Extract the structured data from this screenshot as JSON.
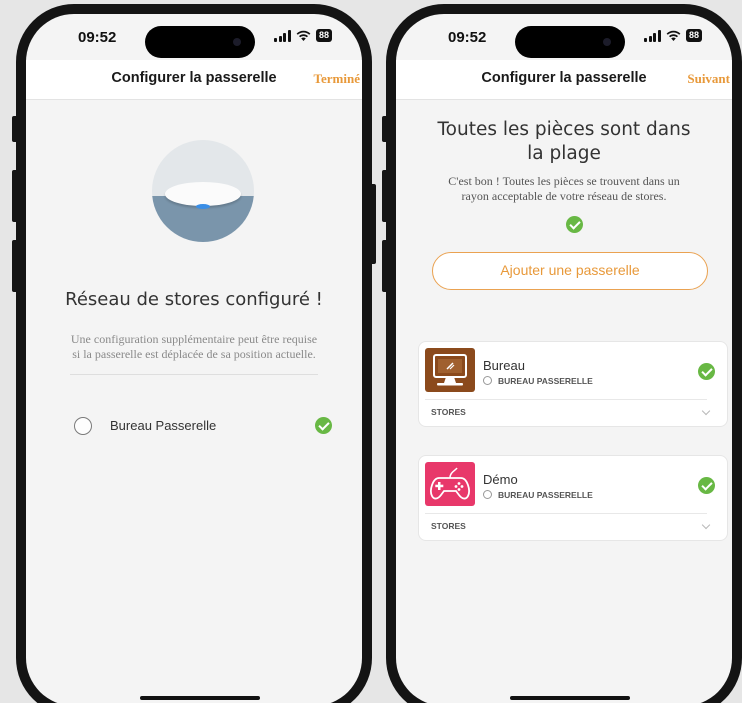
{
  "left": {
    "status": {
      "time": "09:52",
      "battery": "88"
    },
    "nav": {
      "title": "Configurer la passerelle",
      "action": "Terminé"
    },
    "content": {
      "title": "Réseau de stores configuré !",
      "note_line1": "Une configuration supplémentaire peut être requise",
      "note_line2": "si la passerelle est déplacée de sa position actuelle.",
      "gateway_label": "Bureau Passerelle"
    }
  },
  "right": {
    "status": {
      "time": "09:52",
      "battery": "88"
    },
    "nav": {
      "title": "Configurer la passerelle",
      "action": "Suivant"
    },
    "content": {
      "title_line1": "Toutes les pièces sont dans",
      "title_line2": "la plage",
      "text_line1": "C'est bon ! Toutes les pièces se trouvent dans un",
      "text_line2": "rayon acceptable de votre réseau de stores.",
      "add_button": "Ajouter une passerelle"
    },
    "rooms": [
      {
        "name": "Bureau",
        "gateway": "BUREAU PASSERELLE",
        "section": "STORES",
        "icon": "desktop-computer-icon",
        "color": "#8b4a1c"
      },
      {
        "name": "Démo",
        "gateway": "BUREAU PASSERELLE",
        "section": "STORES",
        "icon": "gamepad-icon",
        "color": "#e8386a"
      }
    ]
  },
  "colors": {
    "accent": "#e8993a",
    "check": "#68b844"
  }
}
